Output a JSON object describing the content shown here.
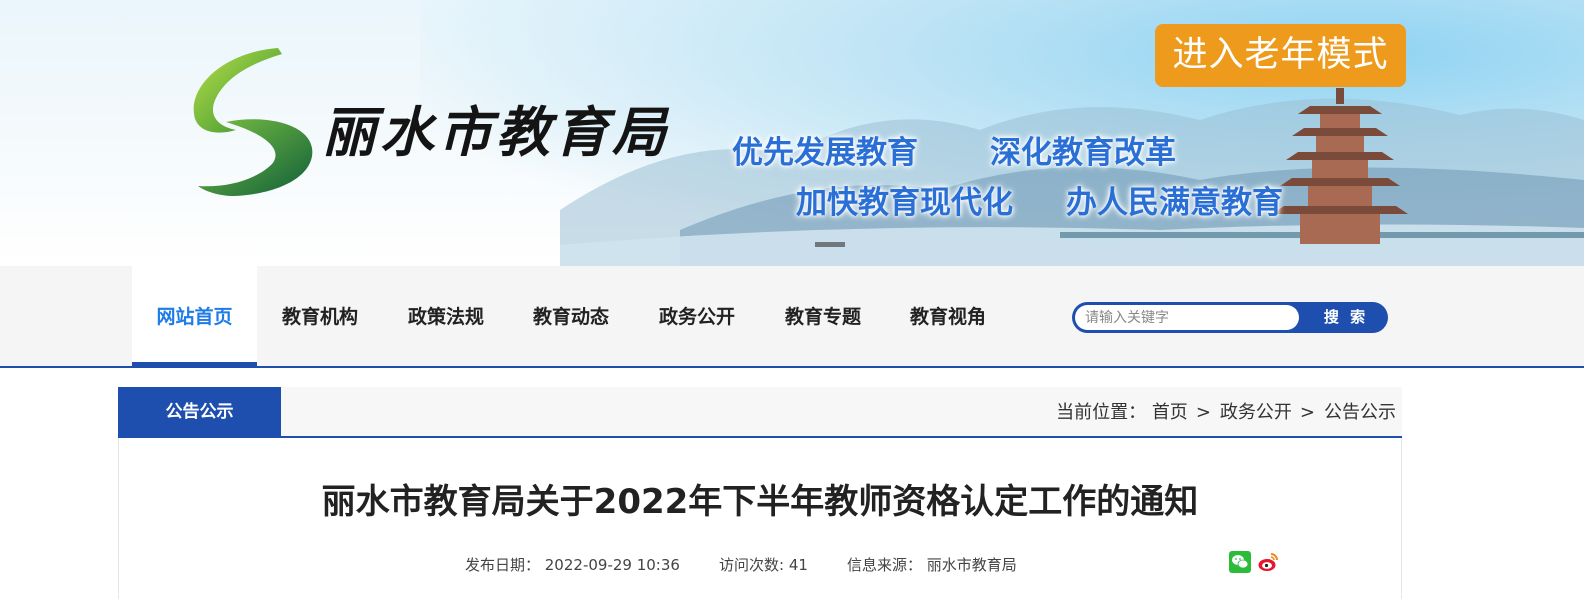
{
  "header": {
    "site_name": "丽水市教育局",
    "slogans": [
      "优先发展教育",
      "深化教育改革",
      "加快教育现代化",
      "办人民满意教育"
    ],
    "elder_mode_label": "进入老年模式"
  },
  "nav": {
    "items": [
      {
        "label": "网站首页",
        "active": true
      },
      {
        "label": "教育机构",
        "active": false
      },
      {
        "label": "政策法规",
        "active": false
      },
      {
        "label": "教育动态",
        "active": false
      },
      {
        "label": "政务公开",
        "active": false
      },
      {
        "label": "教育专题",
        "active": false
      },
      {
        "label": "教育视角",
        "active": false
      }
    ],
    "search": {
      "placeholder": "请输入关键字",
      "button_label": "搜 索"
    }
  },
  "section": {
    "tab_label": "公告公示",
    "breadcrumb": {
      "prefix": "当前位置：",
      "items": [
        "首页",
        "政务公开",
        "公告公示"
      ],
      "separator": ">"
    }
  },
  "article": {
    "title": "丽水市教育局关于2022年下半年教师资格认定工作的通知",
    "published": "发布日期：  2022-09-29  10:36",
    "visits": "访问次数: 41",
    "source": "信息来源：  丽水市教育局"
  },
  "icons": {
    "wechat": "wechat-icon",
    "weibo": "weibo-icon"
  },
  "colors": {
    "primary_blue": "#1e4fae",
    "nav_active_text": "#1e7ce8",
    "elder_button": "#ee9a1c",
    "slogan_text": "#2a6fd6"
  }
}
